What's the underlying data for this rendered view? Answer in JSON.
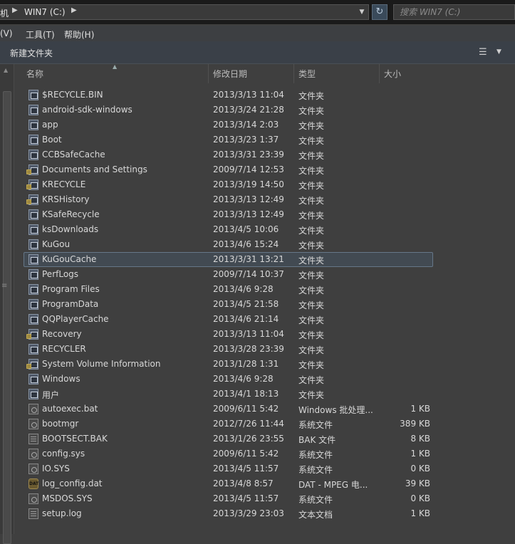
{
  "address": {
    "crumbs": [
      "机",
      "WIN7 (C:)"
    ],
    "separator_icon": "breadcrumb-arrow",
    "dropdown_icon": "chevron-down",
    "refresh_icon": "refresh"
  },
  "search": {
    "placeholder": "搜索 WIN7 (C:)"
  },
  "menu": [
    "(V)",
    "工具(T)",
    "帮助(H)"
  ],
  "toolbar": {
    "new_folder": "新建文件夹",
    "view_icon": "view-options",
    "view_dropdown_icon": "chevron-down"
  },
  "columns": {
    "name": "名称",
    "date": "修改日期",
    "type": "类型",
    "size": "大小"
  },
  "colors": {
    "background": "#3f3f3f",
    "selection_border": "#667788"
  },
  "files": [
    {
      "name": "$RECYCLE.BIN",
      "date": "2013/3/13 11:04",
      "type": "文件夹",
      "size": "",
      "icon": "folder-icon",
      "locked": false,
      "selected": false
    },
    {
      "name": "android-sdk-windows",
      "date": "2013/3/24 21:28",
      "type": "文件夹",
      "size": "",
      "icon": "folder-icon",
      "locked": false,
      "selected": false
    },
    {
      "name": "app",
      "date": "2013/3/14 2:03",
      "type": "文件夹",
      "size": "",
      "icon": "folder-icon",
      "locked": false,
      "selected": false
    },
    {
      "name": "Boot",
      "date": "2013/3/23 1:37",
      "type": "文件夹",
      "size": "",
      "icon": "folder-icon",
      "locked": false,
      "selected": false
    },
    {
      "name": "CCBSafeCache",
      "date": "2013/3/31 23:39",
      "type": "文件夹",
      "size": "",
      "icon": "folder-icon",
      "locked": false,
      "selected": false
    },
    {
      "name": "Documents and Settings",
      "date": "2009/7/14 12:53",
      "type": "文件夹",
      "size": "",
      "icon": "folder-icon",
      "locked": true,
      "selected": false
    },
    {
      "name": "KRECYCLE",
      "date": "2013/3/19 14:50",
      "type": "文件夹",
      "size": "",
      "icon": "folder-icon",
      "locked": true,
      "selected": false
    },
    {
      "name": "KRSHistory",
      "date": "2013/3/13 12:49",
      "type": "文件夹",
      "size": "",
      "icon": "folder-icon",
      "locked": true,
      "selected": false
    },
    {
      "name": "KSafeRecycle",
      "date": "2013/3/13 12:49",
      "type": "文件夹",
      "size": "",
      "icon": "folder-icon",
      "locked": false,
      "selected": false
    },
    {
      "name": "ksDownloads",
      "date": "2013/4/5 10:06",
      "type": "文件夹",
      "size": "",
      "icon": "folder-icon",
      "locked": false,
      "selected": false
    },
    {
      "name": "KuGou",
      "date": "2013/4/6 15:24",
      "type": "文件夹",
      "size": "",
      "icon": "folder-icon",
      "locked": false,
      "selected": false
    },
    {
      "name": "KuGouCache",
      "date": "2013/3/31 13:21",
      "type": "文件夹",
      "size": "",
      "icon": "folder-icon",
      "locked": false,
      "selected": true
    },
    {
      "name": "PerfLogs",
      "date": "2009/7/14 10:37",
      "type": "文件夹",
      "size": "",
      "icon": "folder-icon",
      "locked": false,
      "selected": false
    },
    {
      "name": "Program Files",
      "date": "2013/4/6 9:28",
      "type": "文件夹",
      "size": "",
      "icon": "folder-icon",
      "locked": false,
      "selected": false
    },
    {
      "name": "ProgramData",
      "date": "2013/4/5 21:58",
      "type": "文件夹",
      "size": "",
      "icon": "folder-icon",
      "locked": false,
      "selected": false
    },
    {
      "name": "QQPlayerCache",
      "date": "2013/4/6 21:14",
      "type": "文件夹",
      "size": "",
      "icon": "folder-icon",
      "locked": false,
      "selected": false
    },
    {
      "name": "Recovery",
      "date": "2013/3/13 11:04",
      "type": "文件夹",
      "size": "",
      "icon": "folder-icon",
      "locked": true,
      "selected": false
    },
    {
      "name": "RECYCLER",
      "date": "2013/3/28 23:39",
      "type": "文件夹",
      "size": "",
      "icon": "folder-icon",
      "locked": false,
      "selected": false
    },
    {
      "name": "System Volume Information",
      "date": "2013/1/28 1:31",
      "type": "文件夹",
      "size": "",
      "icon": "folder-icon",
      "locked": true,
      "selected": false
    },
    {
      "name": "Windows",
      "date": "2013/4/6 9:28",
      "type": "文件夹",
      "size": "",
      "icon": "folder-icon",
      "locked": false,
      "selected": false
    },
    {
      "name": "用户",
      "date": "2013/4/1 18:13",
      "type": "文件夹",
      "size": "",
      "icon": "folder-icon",
      "locked": false,
      "selected": false
    },
    {
      "name": "autoexec.bat",
      "date": "2009/6/11 5:42",
      "type": "Windows 批处理...",
      "size": "1 KB",
      "icon": "gear-file-icon",
      "locked": false,
      "selected": false
    },
    {
      "name": "bootmgr",
      "date": "2012/7/26 11:44",
      "type": "系统文件",
      "size": "389 KB",
      "icon": "system-file-icon",
      "locked": false,
      "selected": false
    },
    {
      "name": "BOOTSECT.BAK",
      "date": "2013/1/26 23:55",
      "type": "BAK 文件",
      "size": "8 KB",
      "icon": "blank-file-icon",
      "locked": false,
      "selected": false
    },
    {
      "name": "config.sys",
      "date": "2009/6/11 5:42",
      "type": "系统文件",
      "size": "1 KB",
      "icon": "system-file-icon",
      "locked": false,
      "selected": false
    },
    {
      "name": "IO.SYS",
      "date": "2013/4/5 11:57",
      "type": "系统文件",
      "size": "0 KB",
      "icon": "system-file-icon",
      "locked": false,
      "selected": false
    },
    {
      "name": "log_config.dat",
      "date": "2013/4/8 8:57",
      "type": "DAT - MPEG 电...",
      "size": "39 KB",
      "icon": "dat-file-icon",
      "locked": false,
      "selected": false
    },
    {
      "name": "MSDOS.SYS",
      "date": "2013/4/5 11:57",
      "type": "系统文件",
      "size": "0 KB",
      "icon": "system-file-icon",
      "locked": false,
      "selected": false
    },
    {
      "name": "setup.log",
      "date": "2013/3/29 23:03",
      "type": "文本文档",
      "size": "1 KB",
      "icon": "text-file-icon",
      "locked": false,
      "selected": false
    }
  ]
}
